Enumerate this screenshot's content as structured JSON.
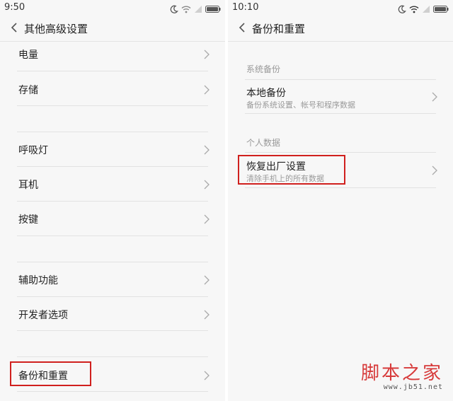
{
  "left_screen": {
    "status": {
      "time": "9:50"
    },
    "title": "其他高级设置",
    "groups": [
      [
        "电量",
        "存储"
      ],
      [
        "呼吸灯",
        "耳机",
        "按键"
      ],
      [
        "辅助功能",
        "开发者选项"
      ],
      [
        "备份和重置"
      ]
    ],
    "highlighted_item": "备份和重置"
  },
  "right_screen": {
    "status": {
      "time": "10:10"
    },
    "title": "备份和重置",
    "sections": [
      {
        "header": "系统备份",
        "item": {
          "label": "本地备份",
          "sub": "备份系统设置、帐号和程序数据"
        }
      },
      {
        "header": "个人数据",
        "item": {
          "label": "恢复出厂设置",
          "sub": "清除手机上的所有数据"
        }
      }
    ],
    "highlighted_item": "恢复出厂设置"
  },
  "icons": [
    "moon-icon",
    "wifi-icon",
    "signal-icon",
    "battery-icon",
    "back-arrow-icon",
    "chevron-right-icon"
  ],
  "colors": {
    "highlight": "#d0201e",
    "watermark": "#d73a3a"
  },
  "watermark": {
    "title": "脚本之家",
    "url": "www.jb51.net"
  }
}
